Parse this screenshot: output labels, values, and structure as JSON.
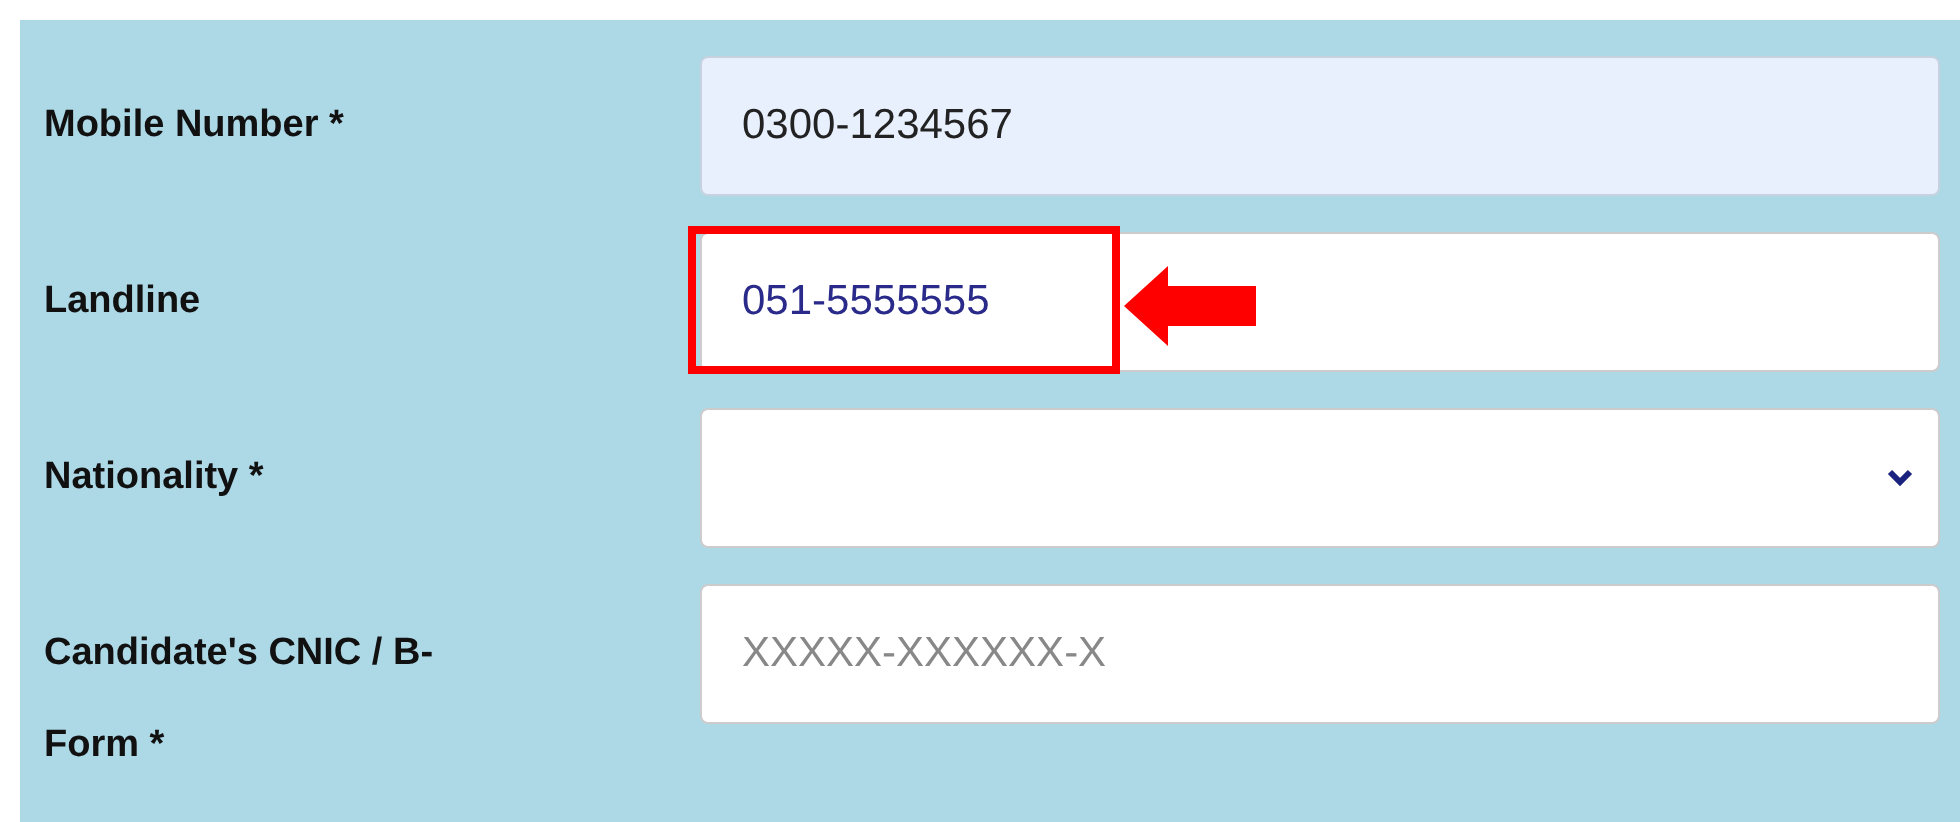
{
  "fields": [
    {
      "label": "Mobile Number *",
      "kind": "text",
      "value": "0300-1234567",
      "autofilled": true,
      "highlighted": false
    },
    {
      "label": "Landline",
      "kind": "text",
      "value": "051-5555555",
      "autofilled": false,
      "highlighted": true
    },
    {
      "label": "Nationality *",
      "kind": "select"
    },
    {
      "label": "Candidate's CNIC / B-Form *",
      "kind": "text",
      "placeholder": "XXXXX-XXXXXX-X",
      "autofilled": false,
      "highlighted": false
    }
  ]
}
